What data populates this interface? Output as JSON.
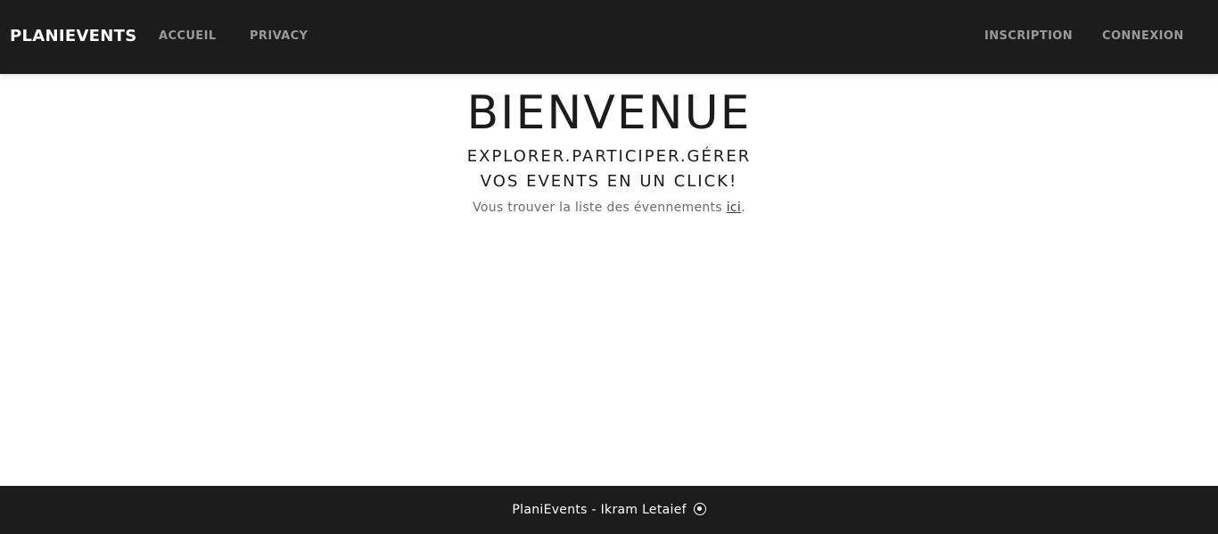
{
  "navbar": {
    "brand": "PLANIEVENTS",
    "links_left": {
      "accueil": "ACCUEIL",
      "privacy": "PRIVACY"
    },
    "links_right": {
      "inscription": "INSCRIPTION",
      "connexion": "CONNEXION"
    },
    "background": "#1c1c1c"
  },
  "hero": {
    "title": "BIENVENUE",
    "subtitle_line1": "EXPLORER.PARTICIPER.GÉRER",
    "subtitle_line2": "VOS EVENTS EN UN CLICK!",
    "text_before_link": "Vous trouver la liste des évennements ",
    "link_text": "ici",
    "text_after_link": "."
  },
  "footer": {
    "text": "PlaniEvents - Ikram Letaief",
    "icon": "copyright-icon"
  }
}
